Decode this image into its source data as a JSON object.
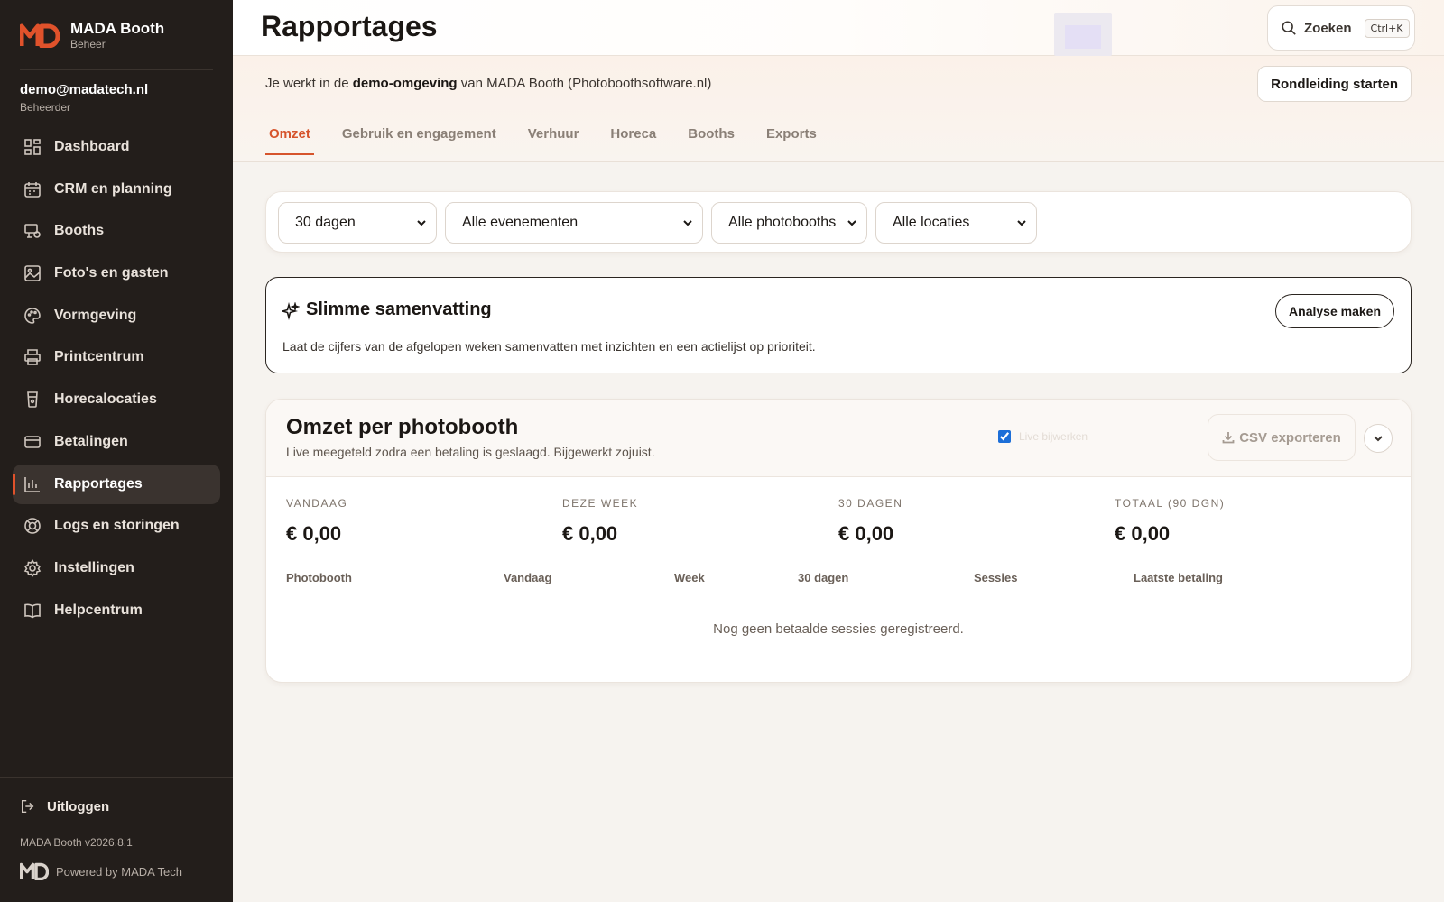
{
  "brand": {
    "name": "MADA Booth",
    "sub": "Beheer"
  },
  "user": {
    "email": "demo@madatech.nl",
    "role": "Beheerder"
  },
  "nav": [
    {
      "label": "Dashboard",
      "icon": "dashboard-icon"
    },
    {
      "label": "CRM en planning",
      "icon": "calendar-icon"
    },
    {
      "label": "Booths",
      "icon": "booth-icon"
    },
    {
      "label": "Foto's en gasten",
      "icon": "image-icon"
    },
    {
      "label": "Vormgeving",
      "icon": "palette-icon"
    },
    {
      "label": "Printcentrum",
      "icon": "printer-icon"
    },
    {
      "label": "Horecalocaties",
      "icon": "glass-icon"
    },
    {
      "label": "Betalingen",
      "icon": "card-icon"
    },
    {
      "label": "Rapportages",
      "icon": "chart-icon",
      "active": true
    },
    {
      "label": "Logs en storingen",
      "icon": "lifebuoy-icon"
    },
    {
      "label": "Instellingen",
      "icon": "gear-icon"
    },
    {
      "label": "Helpcentrum",
      "icon": "book-icon"
    }
  ],
  "logout_label": "Uitloggen",
  "version": "MADA Booth v2026.8.1",
  "powered": "Powered by MADA Tech",
  "page_title": "Rapportages",
  "search": {
    "label": "Zoeken",
    "shortcut": "Ctrl+K"
  },
  "notice": {
    "prefix": "Je werkt in de ",
    "strong": "demo-omgeving",
    "suffix": " van MADA Booth (Photoboothsoftware.nl)"
  },
  "tour_button": "Rondleiding starten",
  "tabs": [
    "Omzet",
    "Gebruik en engagement",
    "Verhuur",
    "Horeca",
    "Booths",
    "Exports"
  ],
  "active_tab": "Omzet",
  "filters": {
    "period": "30 dagen",
    "events": "Alle evenementen",
    "booths": "Alle photobooths",
    "locations": "Alle locaties"
  },
  "summary": {
    "title": "Slimme samenvatting",
    "description": "Laat de cijfers van de afgelopen weken samenvatten met inzichten en een actielijst op prioriteit.",
    "button": "Analyse maken"
  },
  "revenue": {
    "title": "Omzet per photobooth",
    "subtitle": "Live meegeteld zodra een betaling is geslaagd. Bijgewerkt zojuist.",
    "live_label": "Live bijwerken",
    "live_checked": true,
    "csv_button": "CSV exporteren",
    "stats": [
      {
        "label": "VANDAAG",
        "value": "€ 0,00"
      },
      {
        "label": "DEZE WEEK",
        "value": "€ 0,00"
      },
      {
        "label": "30 DAGEN",
        "value": "€ 0,00"
      },
      {
        "label": "TOTAAL (90 DGN)",
        "value": "€ 0,00"
      }
    ],
    "columns": [
      "Photobooth",
      "Vandaag",
      "Week",
      "30 dagen",
      "Sessies",
      "Laatste betaling"
    ],
    "empty": "Nog geen betaalde sessies geregistreerd."
  },
  "colors": {
    "accent": "#d6542c",
    "sidebar": "#231e1b",
    "checkbox": "#1d6fd8"
  }
}
